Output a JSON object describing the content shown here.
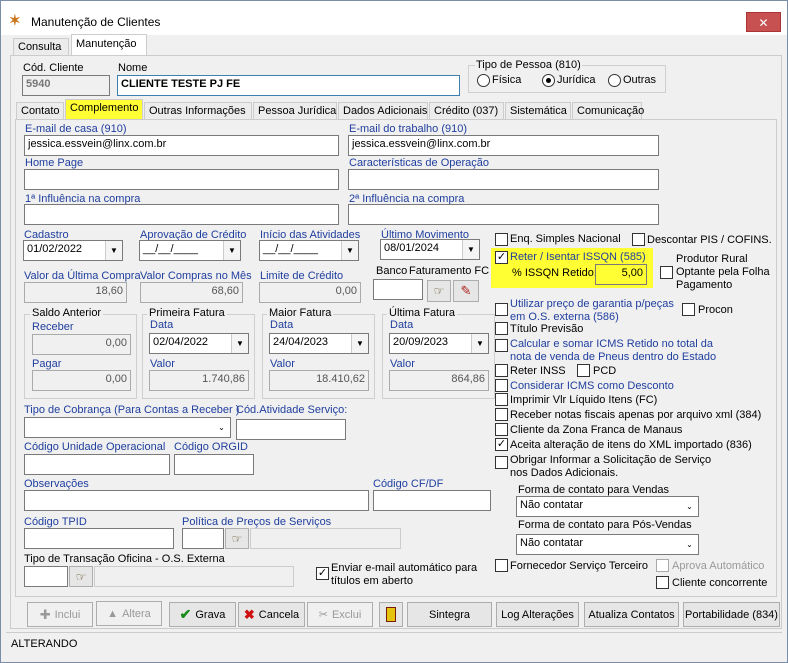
{
  "window": {
    "title": "Manutenção de Clientes",
    "close": "✕"
  },
  "topTabs": [
    "Consulta",
    "Manutenção"
  ],
  "header": {
    "cod_label": "Cód. Cliente",
    "cod_value": "5940",
    "nome_label": "Nome",
    "nome_value": "CLIENTE TESTE PJ FE",
    "tipo_label": "Tipo de Pessoa (810)",
    "tipo_options": [
      "Física",
      "Jurídica",
      "Outras"
    ]
  },
  "subTabs": [
    "Contato",
    "Complemento",
    "Outras Informações",
    "Pessoa Jurídica",
    "Dados Adicionais",
    "Crédito (037)",
    "Sistemática",
    "Comunicação"
  ],
  "contact": {
    "email_casa_label": "E-mail de casa (910)",
    "email_casa": "jessica.essvein@linx.com.br",
    "email_trab_label": "E-mail do trabalho (910)",
    "email_trab": "jessica.essvein@linx.com.br",
    "home_label": "Home Page",
    "caract_label": "Características de Operação",
    "infl1_label": "1ª Influência na compra",
    "infl2_label": "2ª Influência na compra"
  },
  "dates": {
    "cadastro_label": "Cadastro",
    "cadastro": "01/02/2022",
    "aprov_label": "Aprovação de Crédito",
    "aprov": "__/__/____",
    "inicio_label": "Início das Atividades",
    "inicio": "__/__/____",
    "ultimo_label": "Último Movimento",
    "ultimo": "08/01/2024"
  },
  "values": {
    "vuc_label": "Valor da Última Compra",
    "vuc": "18,60",
    "vcm_label": "Valor Compras no Mês",
    "vcm": "68,60",
    "lim_label": "Limite de Crédito",
    "lim": "0,00",
    "banco_label": "Banco",
    "fat_label": "Faturamento FC"
  },
  "saldo": {
    "title": "Saldo Anterior",
    "receber_label": "Receber",
    "receber": "0,00",
    "pagar_label": "Pagar",
    "pagar": "0,00"
  },
  "fat1": {
    "title": "Primeira Fatura",
    "data_label": "Data",
    "data": "02/04/2022",
    "valor_label": "Valor",
    "valor": "1.740,86"
  },
  "fat2": {
    "title": "Maior Fatura",
    "data_label": "Data",
    "data": "24/04/2023",
    "valor_label": "Valor",
    "valor": "18.410,62"
  },
  "fat3": {
    "title": "Última Fatura",
    "data_label": "Data",
    "data": "20/09/2023",
    "valor_label": "Valor",
    "valor": "864,86"
  },
  "misc": {
    "tipo_cob_label": "Tipo de Cobrança (Para Contas a Receber )",
    "cod_ativ_label": "Cód.Atividade Serviço:",
    "cod_unid_label": "Código Unidade Operacional",
    "cod_orgid_label": "Código ORGID",
    "obs_label": "Observações",
    "cod_cfdf_label": "Código CF/DF",
    "cod_tpid_label": "Código TPID",
    "politica_label": "Política de Preços de Serviços",
    "tipo_trans_label": "Tipo de Transação Oficina - O.S. Externa",
    "enviar_email": "Enviar e-mail automático para títulos em aberto"
  },
  "right": {
    "simples": "Enq. Simples Nacional",
    "descontar": "Descontar PIS / COFINS.",
    "reter": "Reter / Isentar ISSQN (585)",
    "pct_label": "% ISSQN Retido:",
    "pct": "5,00",
    "produtor": "Produtor Rural",
    "optante": "Optante pela Folha Pagamento",
    "garantia": "Utilizar preço de garantia p/peças em O.S. externa (586)",
    "procon": "Procon",
    "titulo": "Título Previsão",
    "calcular": "Calcular e somar ICMS Retido no total da nota de venda de Pneus dentro do Estado",
    "inss": "Reter INSS",
    "pcd": "PCD",
    "icms_desc": "Considerar ICMS como Desconto",
    "imprimir": "Imprimir Vlr Líquido Itens (FC)",
    "receber_xml": "Receber notas fiscais apenas por arquivo xml (384)",
    "manaus": "Cliente da Zona Franca de Manaus",
    "aceita": "Aceita alteração de itens do XML importado (836)",
    "obrigar": "Obrigar Informar a Solicitação de Serviço nos Dados Adicionais.",
    "forma_vendas_label": "Forma de contato para Vendas",
    "forma_vendas": "Não contatar",
    "forma_pos_label": "Forma de contato para Pós-Vendas",
    "forma_pos": "Não contatar",
    "fornecedor": "Fornecedor Serviço Terceiro",
    "aprova": "Aprova Automático",
    "concorrente": "Cliente concorrente"
  },
  "buttons": {
    "incluir": "Inclui",
    "altera": "Altera",
    "grava": "Grava",
    "cancela": "Cancela",
    "exclui": "Exclui",
    "sintegra": "Sintegra",
    "log": "Log Alterações",
    "atualiza": "Atualiza Contatos",
    "portabilidade": "Portabilidade (834)"
  },
  "status": "ALTERANDO"
}
